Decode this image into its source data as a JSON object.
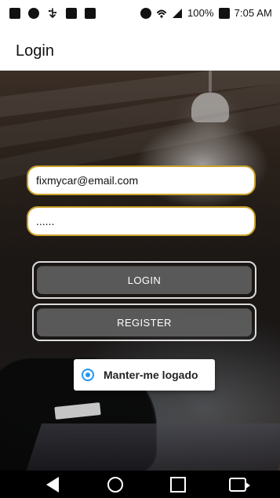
{
  "status_bar": {
    "battery": "100%",
    "time": "7:05 AM",
    "icons": [
      "sim-icon",
      "notification-icon",
      "usb-icon",
      "image-icon",
      "android-icon",
      "alarm-icon",
      "wifi-icon",
      "signal-icon",
      "battery-icon"
    ]
  },
  "header": {
    "title": "Login"
  },
  "form": {
    "email_value": "fixmycar@email.com",
    "password_value": "......"
  },
  "buttons": {
    "login_label": "LOGIN",
    "register_label": "REGISTER"
  },
  "remember": {
    "label": "Manter-me logado"
  },
  "colors": {
    "accent": "#2196f3",
    "input_border": "#caa12d",
    "button_bg": "#5f5f5f"
  },
  "nav_icons": [
    "back-icon",
    "home-icon",
    "recents-icon",
    "rotate-icon"
  ]
}
